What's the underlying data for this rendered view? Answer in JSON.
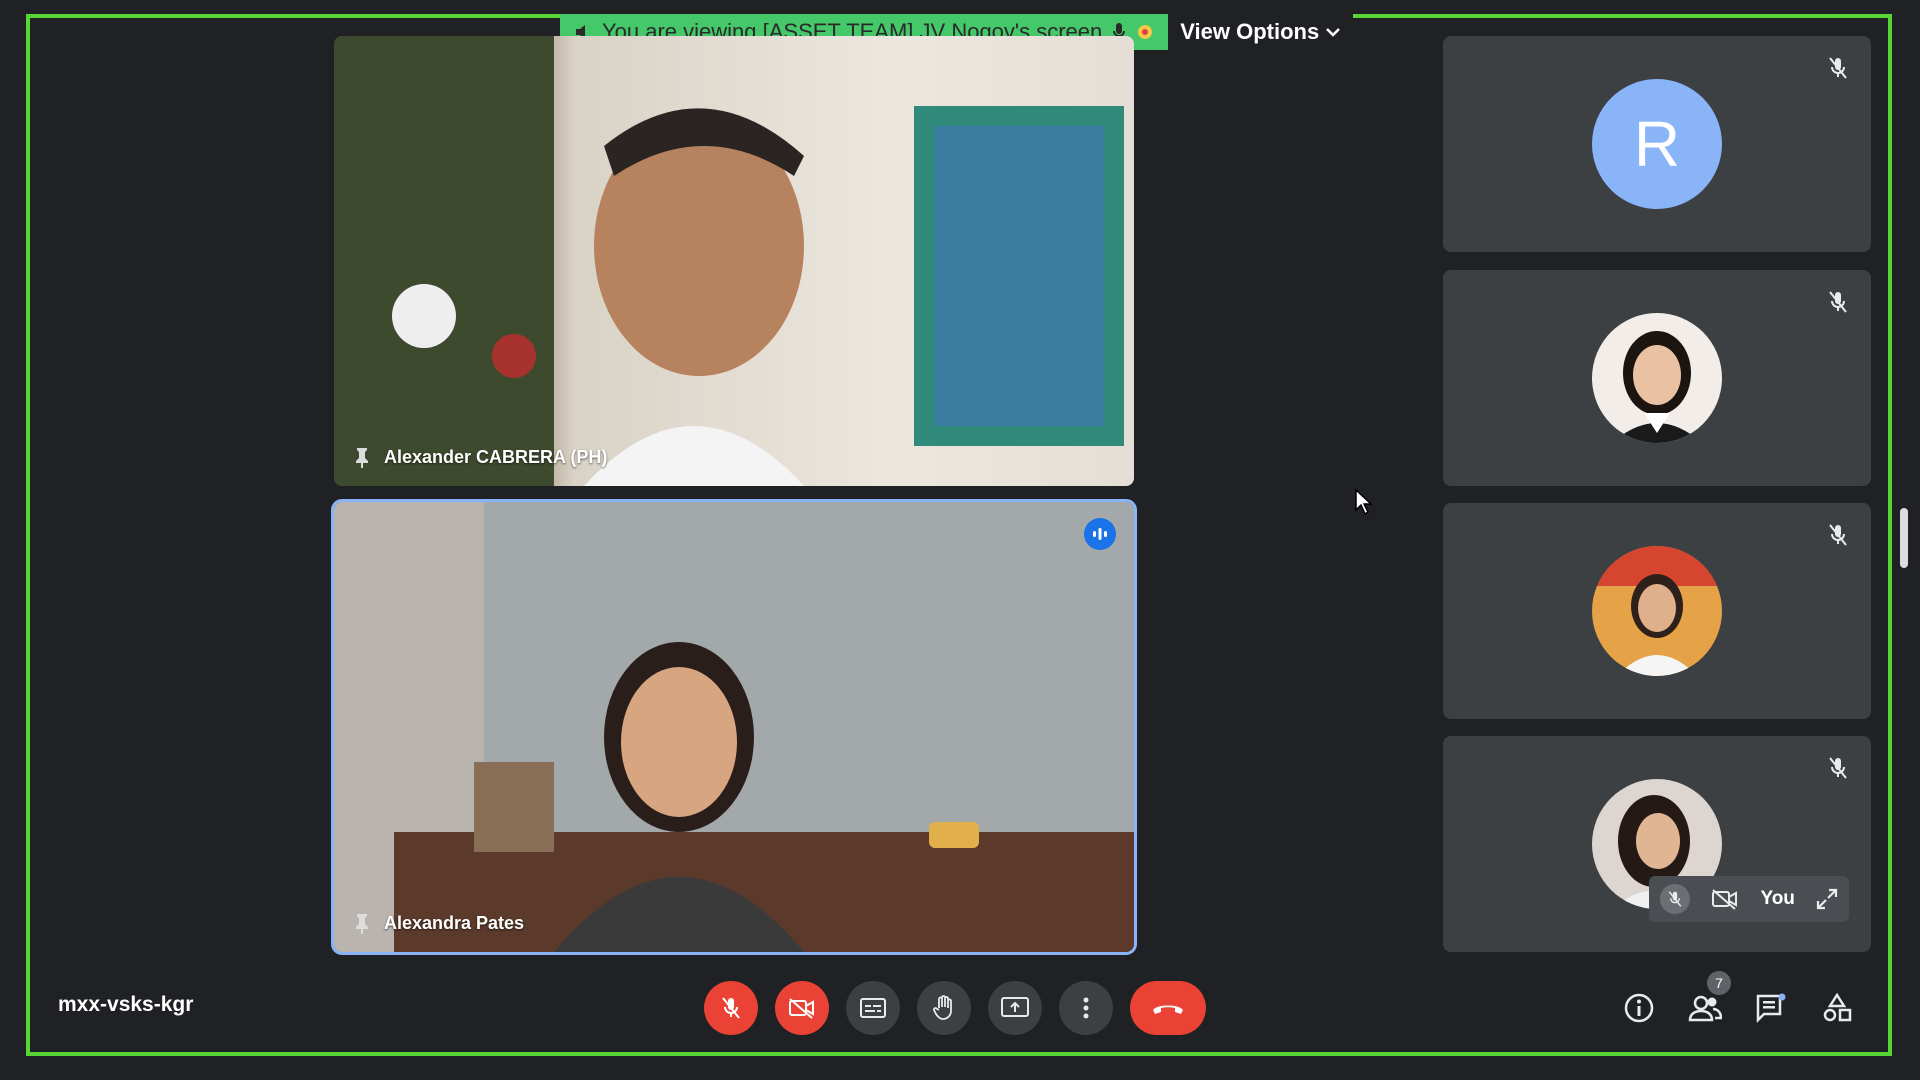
{
  "banner": {
    "message": "You are viewing [ASSET TEAM] JV Nogoy's screen",
    "view_options_label": "View Options"
  },
  "main_tiles": [
    {
      "name": "Alexander CABRERA (PH)"
    },
    {
      "name": "Alexandra Pates"
    }
  ],
  "side_tiles": [
    {
      "avatar_letter": "R",
      "muted": true
    },
    {
      "muted": true
    },
    {
      "muted": true
    },
    {
      "muted": true,
      "you_label": "You"
    }
  ],
  "meeting": {
    "code": "mxx-vsks-kgr"
  },
  "participants_count": "7",
  "colors": {
    "accent_green": "#58d633",
    "banner_green": "#45c86a",
    "danger_red": "#ea4335",
    "avatar_blue": "#8ab4f8"
  }
}
